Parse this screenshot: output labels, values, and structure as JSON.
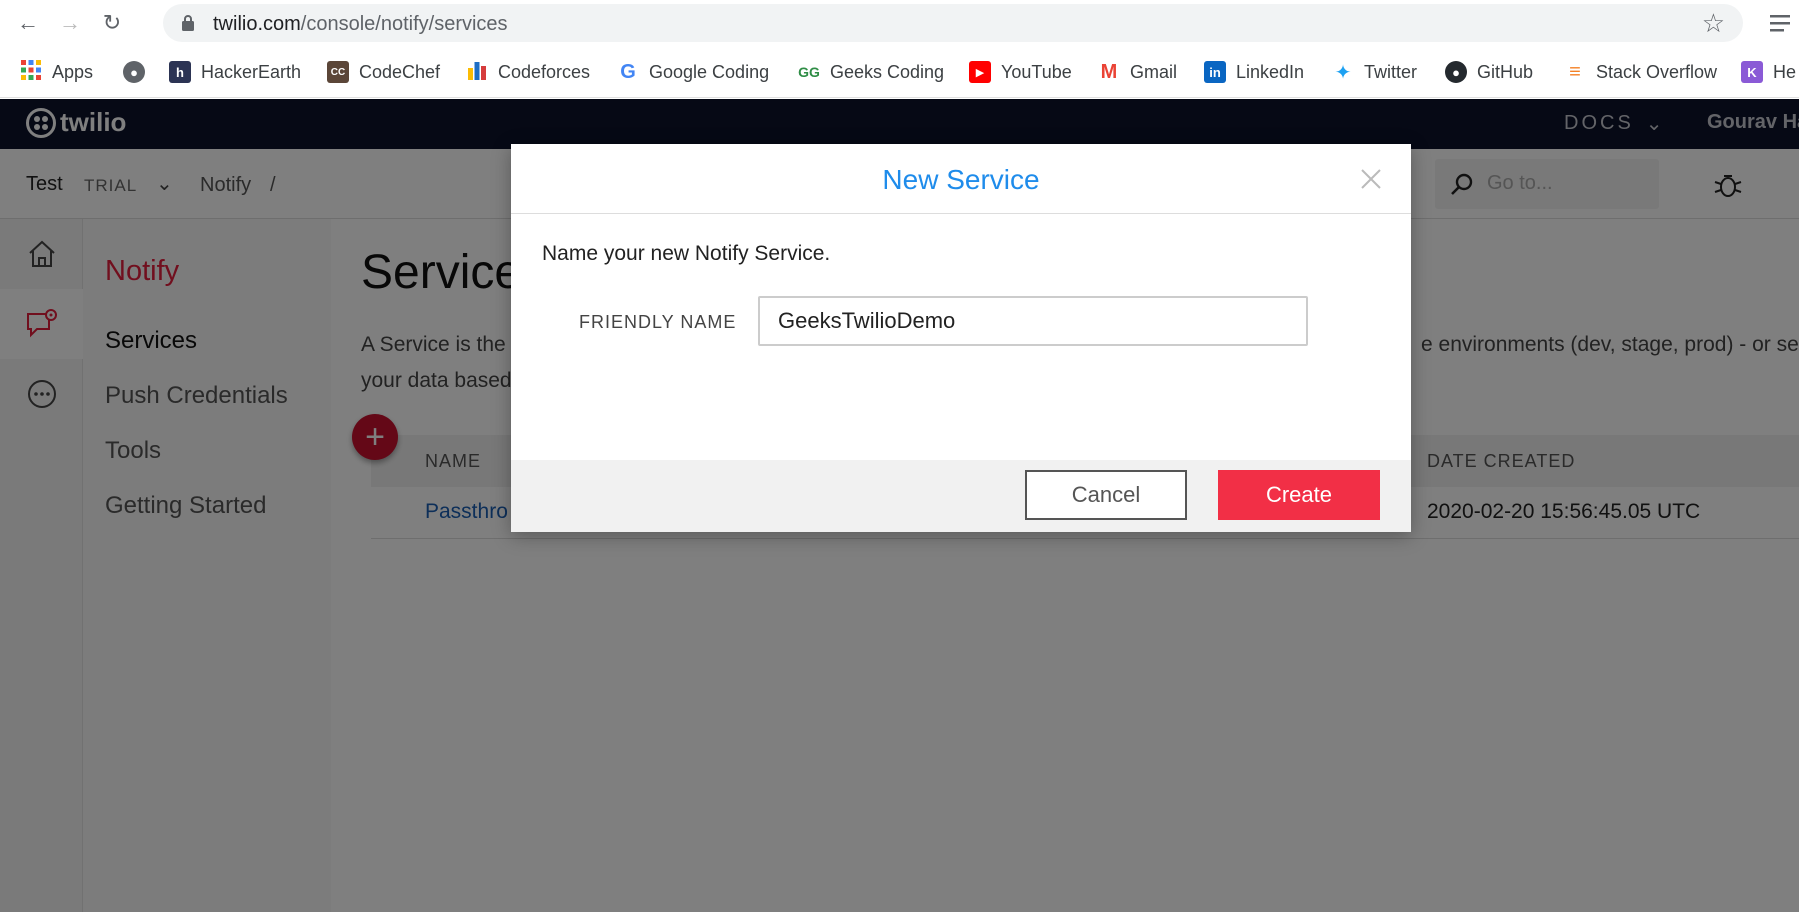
{
  "browser": {
    "url_host": "twilio.com",
    "url_path": "/console/notify/services",
    "bookmarks": [
      {
        "label": "Apps",
        "icon": "apps-grid-icon"
      },
      {
        "label": "",
        "icon": "globe-icon"
      },
      {
        "label": "HackerEarth",
        "icon": "hackerearth-icon"
      },
      {
        "label": "CodeChef",
        "icon": "codechef-icon"
      },
      {
        "label": "Codeforces",
        "icon": "codeforces-icon"
      },
      {
        "label": "Google Coding",
        "icon": "google-icon"
      },
      {
        "label": "Geeks Coding",
        "icon": "geeksforgeeks-icon"
      },
      {
        "label": "YouTube",
        "icon": "youtube-icon"
      },
      {
        "label": "Gmail",
        "icon": "gmail-icon"
      },
      {
        "label": "LinkedIn",
        "icon": "linkedin-icon"
      },
      {
        "label": "Twitter",
        "icon": "twitter-icon"
      },
      {
        "label": "GitHub",
        "icon": "github-icon"
      },
      {
        "label": "Stack Overflow",
        "icon": "stackoverflow-icon"
      },
      {
        "label": "He",
        "icon": "bookmark-k-icon"
      }
    ]
  },
  "twilio_header": {
    "logo": "twilio",
    "docs": "DOCS",
    "user": "Gourav Ha"
  },
  "subbar": {
    "project": "Test",
    "tier": "TRIAL",
    "breadcrumb": "Notify",
    "separator": "/",
    "search_placeholder": "Go to..."
  },
  "subnav": {
    "title": "Notify",
    "items": [
      "Services",
      "Push Credentials",
      "Tools",
      "Getting Started"
    ]
  },
  "main": {
    "title": "Service",
    "desc_line1": "A Service is the",
    "desc_line1_right": "e environments (dev, stage, prod) - or se",
    "desc_line2": "your data based",
    "columns": {
      "name": "NAME",
      "date": "DATE CREATED"
    },
    "rows": [
      {
        "name": "Passthro",
        "date": "2020-02-20 15:56:45.05 UTC"
      }
    ],
    "add": "+"
  },
  "modal": {
    "title": "New Service",
    "prompt": "Name your new Notify Service.",
    "field_label": "FRIENDLY NAME",
    "field_value": "GeeksTwilioDemo",
    "cancel": "Cancel",
    "create": "Create"
  },
  "colors": {
    "twilio_red": "#f22f46",
    "modal_title_blue": "#1f8ceb",
    "header_navy": "#0d122b"
  }
}
